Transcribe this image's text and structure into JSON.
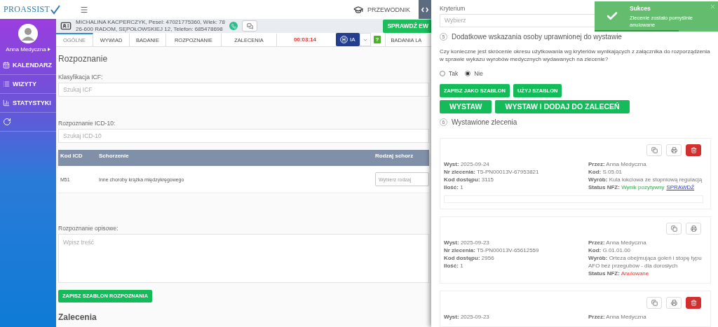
{
  "header": {
    "logo": "PROASSIST",
    "guide": "PRZEWODNIK"
  },
  "user": {
    "name": "Anna Medyczna"
  },
  "nav": [
    {
      "label": "KALENDARZ",
      "kind": "calendar"
    },
    {
      "label": "WIZYTY",
      "kind": "list"
    },
    {
      "label": "STATYSTYKI",
      "kind": "stats"
    },
    {
      "kind": "history"
    }
  ],
  "patient": {
    "line1": "MICHALINA KACPERCZYK, Pesel: 47021775360, Wiek: 78",
    "line2": "26-600 RADOM, SĘPOŁOWSKIEJ 12, Telefon: 685478698",
    "check_button": "SPRAWDŹ EW"
  },
  "tabs": [
    {
      "label": "OGÓLNE",
      "selected": true
    },
    {
      "label": "WYWIAD",
      "selected": false
    },
    {
      "label": "BADANIE",
      "selected": false
    },
    {
      "label": "ROZPOZNANIE",
      "selected": false
    },
    {
      "label": "ZALECENIA",
      "selected": false
    }
  ],
  "timer": "00:03:14",
  "ai_button": "IA",
  "help": "?",
  "tabs_after": [
    {
      "label": "BADANIA LA",
      "selected": false
    }
  ],
  "diagnosis": {
    "title": "Rozpoznanie",
    "icf": {
      "label": "Klasyfikacja ICF:",
      "placeholder": "Szukaj ICF"
    },
    "icd": {
      "label": "Rozpoznanie ICD-10:",
      "placeholder": "Szukaj ICD-10"
    },
    "table": {
      "columns": [
        "Kod ICD",
        "Schorzenie",
        "Rodzaj schorz"
      ],
      "rows": [
        {
          "code": "M51",
          "name": "Inne choroby krążka międzykręgowego",
          "type_placeholder": "Wybierz rodzaj"
        }
      ]
    },
    "description": {
      "label": "Rozpoznanie opisowe:",
      "placeholder": "Wpisz treść"
    },
    "save_button": "ZAPISZ SZABLON ROZPOZNANIA"
  },
  "recommendations": {
    "title": "Zalecenia"
  },
  "drawer": {
    "criterion": {
      "label": "Kryterium",
      "placeholder": "Wybierz"
    },
    "step5": {
      "number": "5",
      "title": "Dodatkowe wskazania osoby uprawnionej do wystawie"
    },
    "question": {
      "text": "Czy konieczne jest skrócenie okresu użytkowania wg kryteriów wynikających z załącznika do rozporządzenia w sprawie wykazu wyrobów medycznych wydawanych na zlecenie?",
      "options": [
        {
          "label": "Tak",
          "selected": false
        },
        {
          "label": "Nie",
          "selected": true
        }
      ]
    },
    "template_buttons": [
      "ZAPISZ JAKO SZABLON",
      "UŻYJ SZABLON"
    ],
    "issue_buttons": [
      "WYSTAW",
      "WYSTAW I DODAJ DO ZALECEŃ"
    ],
    "step6": {
      "number": "6",
      "title": "Wystawione zlecenia"
    },
    "orders": [
      {
        "actions": [
          {
            "kind": "copy"
          },
          {
            "kind": "print"
          },
          {
            "kind": "delete"
          }
        ],
        "left": [
          {
            "label": "Wyst:",
            "value": "2025-09-24"
          },
          {
            "label": "Nr zlecenia:",
            "value": "T5-PN00013V-67953821"
          },
          {
            "label": "Kod dostępu:",
            "value": "3115"
          },
          {
            "label": "Ilość:",
            "value": "1"
          }
        ],
        "right": [
          {
            "label": "Przez:",
            "value": "Anna Medyczna"
          },
          {
            "label": "Kod:",
            "value": "S.05.01"
          },
          {
            "label": "Wyrób:",
            "value": "Kula łokciowa ze stopniową regulacją"
          }
        ],
        "status": {
          "label": "Status NFZ:",
          "value": "Wynik pozytywny",
          "kind": "positive",
          "link": "SPRAWDŹ"
        },
        "has_note": true
      },
      {
        "actions": [
          {
            "kind": "copy"
          },
          {
            "kind": "print"
          }
        ],
        "left": [
          {
            "label": "Wyst:",
            "value": "2025-09-23"
          },
          {
            "label": "Nr zlecenia:",
            "value": "T5-PN00013V-65612559"
          },
          {
            "label": "Kod dostępu:",
            "value": "2956"
          },
          {
            "label": "Ilość:",
            "value": "1"
          }
        ],
        "right": [
          {
            "label": "Przez:",
            "value": "Anna Medyczna"
          },
          {
            "label": "Kod:",
            "value": "G.01.01.00"
          },
          {
            "label": "Wyrób:",
            "value": "Orteza obejmująca goleń i stopę typu AFO bez przegubów - dla dorosłych"
          }
        ],
        "status": {
          "label": "Status NFZ:",
          "value": "Anulowane",
          "kind": "cancelled"
        },
        "has_note": false
      },
      {
        "actions": [
          {
            "kind": "copy"
          },
          {
            "kind": "print"
          },
          {
            "kind": "delete"
          }
        ],
        "left": [
          {
            "label": "Wyst:",
            "value": "2025-09-23"
          }
        ],
        "right": [
          {
            "label": "Przez:",
            "value": "Anna Medyczna"
          }
        ],
        "has_note": false
      }
    ]
  },
  "toast": {
    "title": "Sukces",
    "message": "Zlecenie zostało pomyślnie anulowane",
    "level": 0.68
  }
}
